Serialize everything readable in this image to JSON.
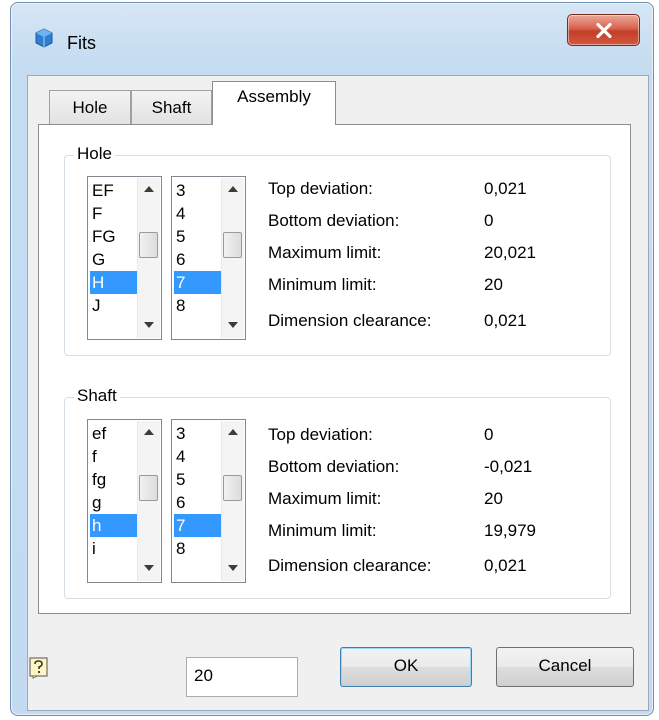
{
  "window": {
    "title": "Fits"
  },
  "tabs": [
    {
      "label": "Hole"
    },
    {
      "label": "Shaft"
    },
    {
      "label": "Assembly"
    }
  ],
  "hole": {
    "group_label": "Hole",
    "letters": [
      "EF",
      "F",
      "FG",
      "G",
      "H",
      "J"
    ],
    "selected_letter": "H",
    "grades": [
      "3",
      "4",
      "5",
      "6",
      "7",
      "8"
    ],
    "selected_grade": "7",
    "info": [
      {
        "label": "Top deviation:",
        "value": "0,021"
      },
      {
        "label": "Bottom deviation:",
        "value": "0"
      },
      {
        "label": "Maximum limit:",
        "value": "20,021"
      },
      {
        "label": "Minimum limit:",
        "value": "20"
      },
      {
        "label": "Dimension clearance:",
        "value": "0,021"
      }
    ]
  },
  "shaft": {
    "group_label": "Shaft",
    "letters": [
      "ef",
      "f",
      "fg",
      "g",
      "h",
      "i"
    ],
    "selected_letter": "h",
    "grades": [
      "3",
      "4",
      "5",
      "6",
      "7",
      "8"
    ],
    "selected_grade": "7",
    "info": [
      {
        "label": "Top deviation:",
        "value": "0"
      },
      {
        "label": "Bottom deviation:",
        "value": "-0,021"
      },
      {
        "label": "Maximum limit:",
        "value": "20"
      },
      {
        "label": "Minimum limit:",
        "value": "19,979"
      },
      {
        "label": "Dimension clearance:",
        "value": "0,021"
      }
    ]
  },
  "footer": {
    "nominal_size": "20",
    "ok_label": "OK",
    "cancel_label": "Cancel"
  },
  "icons": {
    "app": "app-icon",
    "close": "close-icon",
    "help": "help-icon",
    "scroll_up": "scroll-up-arrow-icon",
    "scroll_down": "scroll-down-arrow-icon"
  },
  "colors": {
    "selection": "#3399ff",
    "close_button": "#c9473a",
    "window_frame": "#c4daf1"
  }
}
